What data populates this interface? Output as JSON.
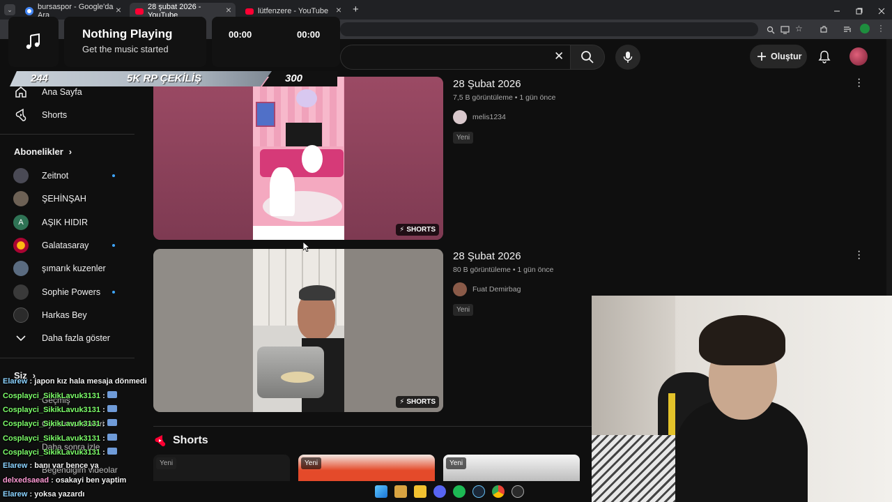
{
  "browser": {
    "tabs": [
      {
        "title": "bursaspor - Google'da Ara",
        "active": false
      },
      {
        "title": "28 şubat 2026 - YouTube",
        "active": true
      },
      {
        "title": "lütfenzere - YouTube",
        "active": false
      }
    ],
    "new_tab": "+",
    "close_glyph": "×"
  },
  "music_widget": {
    "title": "Nothing Playing",
    "subtitle": "Get the music started",
    "time_elapsed": "00:00",
    "time_total": "00:00"
  },
  "rp_banner": {
    "left_number": "244",
    "center_text": "5K RP ÇEKİLİŞ",
    "right_number": "300"
  },
  "youtube_header": {
    "clear_glyph": "✕",
    "create_label": "Oluştur"
  },
  "sidebar": {
    "home_label": "Ana Sayfa",
    "shorts_label": "Shorts",
    "subscriptions_heading": "Abonelikler",
    "subscriptions": [
      {
        "name": "Zeitnot",
        "live_dot": true
      },
      {
        "name": "ŞEHİNŞAH",
        "live_dot": false
      },
      {
        "name": "AŞIK HIDIR",
        "live_dot": false,
        "initial": "A"
      },
      {
        "name": "Galatasaray",
        "live_dot": true
      },
      {
        "name": "şımarık kuzenler",
        "live_dot": false
      },
      {
        "name": "Sophie Powers",
        "live_dot": true
      },
      {
        "name": "Harkas Bey",
        "live_dot": false
      }
    ],
    "show_more_label": "Daha fazla göster",
    "you_heading": "Siz",
    "you_items": [
      "Geçmiş",
      "Oynatma listeleri",
      "Daha sonra izle",
      "Beğendiğim videolar"
    ]
  },
  "videos": [
    {
      "title": "28 Şubat 2026",
      "views": "7,5 B görüntüleme",
      "age": "1 gün önce",
      "channel": "melis1234",
      "badge": "Yeni",
      "shorts_label": "SHORTS"
    },
    {
      "title": "28 Şubat 2026",
      "views": "80 B görüntüleme",
      "age": "1 gün önce",
      "channel": "Fuat Demirbag",
      "badge": "Yeni",
      "shorts_label": "SHORTS"
    }
  ],
  "meta_separator": "•",
  "shorts_section": {
    "heading": "Shorts",
    "badges": [
      "Yeni",
      "Yeni",
      "Yeni"
    ]
  },
  "chat": [
    {
      "user": "Elarew",
      "message": "japon kız hala mesaja dönmedi"
    },
    {
      "user": "Cosplayci_SikikLavuk3131",
      "message": ""
    },
    {
      "user": "Cosplayci_SikikLavuk3131",
      "message": ""
    },
    {
      "user": "Cosplayci_SikikLavuk3131",
      "message": ""
    },
    {
      "user": "Cosplayci_SikikLavuk3131",
      "message": ""
    },
    {
      "user": "Elarew",
      "message": "banı var bence ya"
    },
    {
      "user": "delxedsaead",
      "message": "osakayi ben yaptim"
    },
    {
      "user": "Elarew",
      "message": "yoksa yazardı"
    }
  ],
  "chat_separator": ":",
  "colors": {
    "background": "#0f0f0f",
    "accent_red": "#ff0033",
    "link_blue": "#3ea6ff",
    "muted_text": "#aaaaaa"
  }
}
